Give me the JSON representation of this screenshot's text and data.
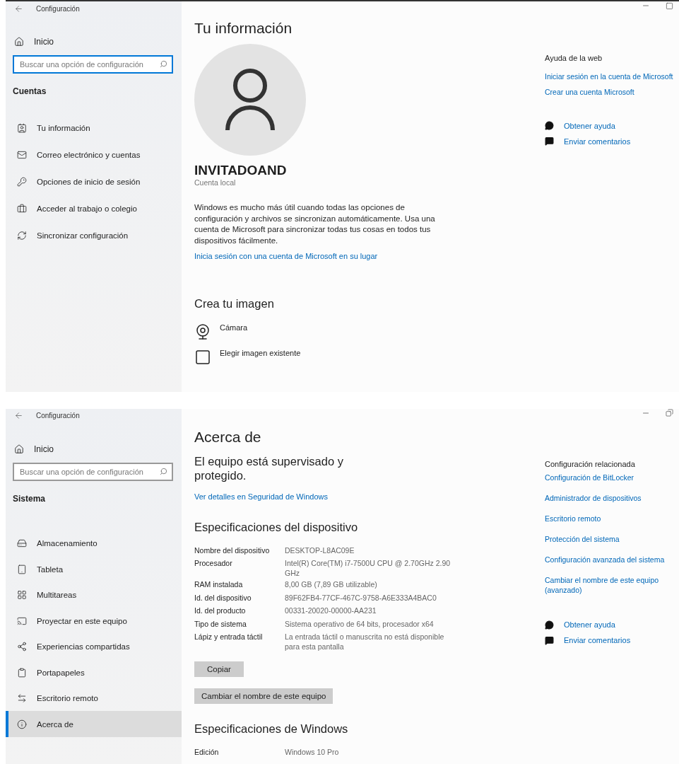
{
  "windows": [
    {
      "title": "Configuración",
      "maximized": false,
      "sidebar": {
        "home": "Inicio",
        "search": {
          "placeholder": "Buscar una opción de configuración",
          "focused": true
        },
        "section": "Cuentas",
        "items": [
          {
            "label": "Tu información",
            "selected": false
          },
          {
            "label": "Correo electrónico y cuentas",
            "selected": false
          },
          {
            "label": "Opciones de inicio de sesión",
            "selected": false
          },
          {
            "label": "Acceder al trabajo o colegio",
            "selected": false
          },
          {
            "label": "Sincronizar configuración",
            "selected": false
          }
        ]
      },
      "main": [
        {
          "kind": "heading",
          "text": "Tu información"
        },
        {
          "kind": "avatar"
        },
        {
          "kind": "name",
          "text": "INVITADOAND"
        },
        {
          "kind": "subtext",
          "text": "Cuenta local"
        },
        {
          "kind": "paragraph",
          "text": "Windows es mucho más útil cuando todas las opciones de configuración y archivos se sincronizan automáticamente. Usa una cuenta de Microsoft para sincronizar todas tus cosas en todos tus dispositivos fácilmente."
        },
        {
          "kind": "link",
          "text": "Inicia sesión con una cuenta de Microsoft en su lugar"
        },
        {
          "kind": "subheading",
          "text": "Crea tu imagen"
        },
        {
          "kind": "option",
          "text": "Cámara"
        },
        {
          "kind": "option",
          "text": "Elegir imagen existente"
        }
      ],
      "aside": {
        "heading": "Ayuda de la web",
        "links": [
          "Iniciar sesión en la cuenta de Microsoft",
          "Crear una cuenta Microsoft"
        ],
        "help": [
          "Obtener ayuda",
          "Enviar comentarios"
        ]
      }
    },
    {
      "title": "Configuración",
      "maximized": true,
      "sidebar": {
        "home": "Inicio",
        "search": {
          "placeholder": "Buscar una opción de configuración",
          "focused": false
        },
        "section": "Sistema",
        "items": [
          {
            "label": "Almacenamiento",
            "selected": false
          },
          {
            "label": "Tableta",
            "selected": false
          },
          {
            "label": "Multitareas",
            "selected": false
          },
          {
            "label": "Proyectar en este equipo",
            "selected": false
          },
          {
            "label": "Experiencias compartidas",
            "selected": false
          },
          {
            "label": "Portapapeles",
            "selected": false
          },
          {
            "label": "Escritorio remoto",
            "selected": false
          },
          {
            "label": "Acerca de",
            "selected": true
          }
        ]
      },
      "main": [
        {
          "kind": "heading",
          "text": "Acerca de"
        },
        {
          "kind": "lead",
          "text": "El equipo está supervisado y protegido."
        },
        {
          "kind": "link",
          "text": "Ver detalles en Seguridad de Windows"
        },
        {
          "kind": "subheading",
          "text": "Especificaciones del dispositivo"
        },
        {
          "kind": "specs",
          "rows": [
            {
              "label": "Nombre del dispositivo",
              "value": "DESKTOP-L8AC09E"
            },
            {
              "label": "Procesador",
              "value": "Intel(R) Core(TM) i7-7500U CPU @ 2.70GHz 2.90 GHz"
            },
            {
              "label": "RAM instalada",
              "value": "8,00 GB (7,89 GB utilizable)"
            },
            {
              "label": "Id. del dispositivo",
              "value": "89F62FB4-77CF-467C-9758-A6E333A4BAC0"
            },
            {
              "label": "Id. del producto",
              "value": "00331-20020-00000-AA231"
            },
            {
              "label": "Tipo de sistema",
              "value": "Sistema operativo de 64 bits, procesador x64"
            },
            {
              "label": "Lápiz y entrada táctil",
              "value": "La entrada táctil o manuscrita no está disponible para esta pantalla"
            }
          ]
        },
        {
          "kind": "button",
          "text": "Copiar"
        },
        {
          "kind": "button",
          "text": "Cambiar el nombre de este equipo"
        },
        {
          "kind": "subheading",
          "text": "Especificaciones de Windows"
        },
        {
          "kind": "specs",
          "rows": [
            {
              "label": "Edición",
              "value": "Windows 10 Pro"
            }
          ]
        }
      ],
      "aside": {
        "heading": "Configuración relacionada",
        "links": [
          "Configuración de BitLocker",
          "Administrador de dispositivos",
          "Escritorio remoto",
          "Protección del sistema",
          "Configuración avanzada del sistema",
          "Cambiar el nombre de este equipo (avanzado)"
        ],
        "help": [
          "Obtener ayuda",
          "Enviar comentarios"
        ]
      }
    }
  ]
}
